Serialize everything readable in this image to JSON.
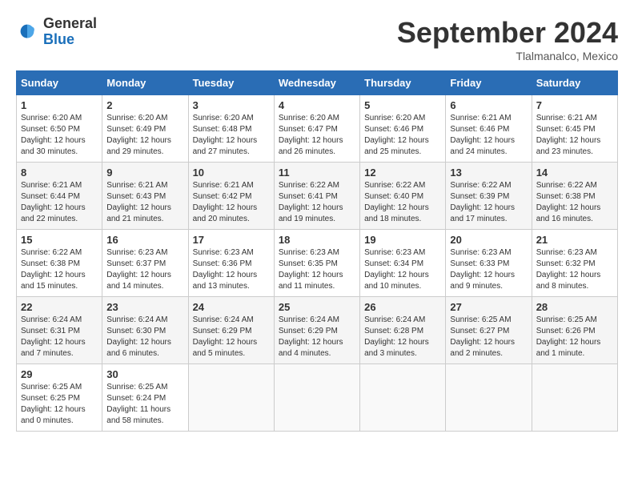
{
  "logo": {
    "general": "General",
    "blue": "Blue"
  },
  "title": "September 2024",
  "subtitle": "Tlalmanalco, Mexico",
  "headers": [
    "Sunday",
    "Monday",
    "Tuesday",
    "Wednesday",
    "Thursday",
    "Friday",
    "Saturday"
  ],
  "weeks": [
    [
      {
        "day": "1",
        "sunrise": "6:20 AM",
        "sunset": "6:50 PM",
        "daylight": "12 hours and 30 minutes."
      },
      {
        "day": "2",
        "sunrise": "6:20 AM",
        "sunset": "6:49 PM",
        "daylight": "12 hours and 29 minutes."
      },
      {
        "day": "3",
        "sunrise": "6:20 AM",
        "sunset": "6:48 PM",
        "daylight": "12 hours and 27 minutes."
      },
      {
        "day": "4",
        "sunrise": "6:20 AM",
        "sunset": "6:47 PM",
        "daylight": "12 hours and 26 minutes."
      },
      {
        "day": "5",
        "sunrise": "6:20 AM",
        "sunset": "6:46 PM",
        "daylight": "12 hours and 25 minutes."
      },
      {
        "day": "6",
        "sunrise": "6:21 AM",
        "sunset": "6:46 PM",
        "daylight": "12 hours and 24 minutes."
      },
      {
        "day": "7",
        "sunrise": "6:21 AM",
        "sunset": "6:45 PM",
        "daylight": "12 hours and 23 minutes."
      }
    ],
    [
      {
        "day": "8",
        "sunrise": "6:21 AM",
        "sunset": "6:44 PM",
        "daylight": "12 hours and 22 minutes."
      },
      {
        "day": "9",
        "sunrise": "6:21 AM",
        "sunset": "6:43 PM",
        "daylight": "12 hours and 21 minutes."
      },
      {
        "day": "10",
        "sunrise": "6:21 AM",
        "sunset": "6:42 PM",
        "daylight": "12 hours and 20 minutes."
      },
      {
        "day": "11",
        "sunrise": "6:22 AM",
        "sunset": "6:41 PM",
        "daylight": "12 hours and 19 minutes."
      },
      {
        "day": "12",
        "sunrise": "6:22 AM",
        "sunset": "6:40 PM",
        "daylight": "12 hours and 18 minutes."
      },
      {
        "day": "13",
        "sunrise": "6:22 AM",
        "sunset": "6:39 PM",
        "daylight": "12 hours and 17 minutes."
      },
      {
        "day": "14",
        "sunrise": "6:22 AM",
        "sunset": "6:38 PM",
        "daylight": "12 hours and 16 minutes."
      }
    ],
    [
      {
        "day": "15",
        "sunrise": "6:22 AM",
        "sunset": "6:38 PM",
        "daylight": "12 hours and 15 minutes."
      },
      {
        "day": "16",
        "sunrise": "6:23 AM",
        "sunset": "6:37 PM",
        "daylight": "12 hours and 14 minutes."
      },
      {
        "day": "17",
        "sunrise": "6:23 AM",
        "sunset": "6:36 PM",
        "daylight": "12 hours and 13 minutes."
      },
      {
        "day": "18",
        "sunrise": "6:23 AM",
        "sunset": "6:35 PM",
        "daylight": "12 hours and 11 minutes."
      },
      {
        "day": "19",
        "sunrise": "6:23 AM",
        "sunset": "6:34 PM",
        "daylight": "12 hours and 10 minutes."
      },
      {
        "day": "20",
        "sunrise": "6:23 AM",
        "sunset": "6:33 PM",
        "daylight": "12 hours and 9 minutes."
      },
      {
        "day": "21",
        "sunrise": "6:23 AM",
        "sunset": "6:32 PM",
        "daylight": "12 hours and 8 minutes."
      }
    ],
    [
      {
        "day": "22",
        "sunrise": "6:24 AM",
        "sunset": "6:31 PM",
        "daylight": "12 hours and 7 minutes."
      },
      {
        "day": "23",
        "sunrise": "6:24 AM",
        "sunset": "6:30 PM",
        "daylight": "12 hours and 6 minutes."
      },
      {
        "day": "24",
        "sunrise": "6:24 AM",
        "sunset": "6:29 PM",
        "daylight": "12 hours and 5 minutes."
      },
      {
        "day": "25",
        "sunrise": "6:24 AM",
        "sunset": "6:29 PM",
        "daylight": "12 hours and 4 minutes."
      },
      {
        "day": "26",
        "sunrise": "6:24 AM",
        "sunset": "6:28 PM",
        "daylight": "12 hours and 3 minutes."
      },
      {
        "day": "27",
        "sunrise": "6:25 AM",
        "sunset": "6:27 PM",
        "daylight": "12 hours and 2 minutes."
      },
      {
        "day": "28",
        "sunrise": "6:25 AM",
        "sunset": "6:26 PM",
        "daylight": "12 hours and 1 minute."
      }
    ],
    [
      {
        "day": "29",
        "sunrise": "6:25 AM",
        "sunset": "6:25 PM",
        "daylight": "12 hours and 0 minutes."
      },
      {
        "day": "30",
        "sunrise": "6:25 AM",
        "sunset": "6:24 PM",
        "daylight": "11 hours and 58 minutes."
      },
      null,
      null,
      null,
      null,
      null
    ]
  ],
  "labels": {
    "sunrise": "Sunrise:",
    "sunset": "Sunset:",
    "daylight": "Daylight:"
  }
}
